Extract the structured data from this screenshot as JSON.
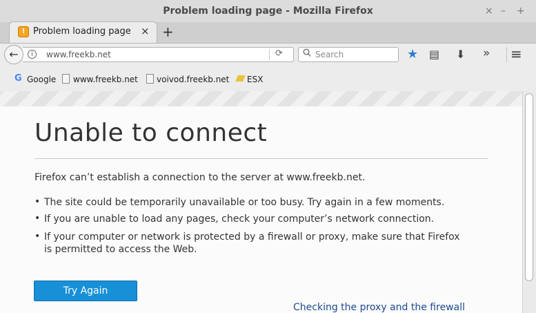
{
  "window": {
    "title": "Problem loading page - Mozilla Firefox",
    "controls": {
      "close": "×",
      "minimize": "–",
      "maximize": "+"
    }
  },
  "tabs": [
    {
      "title": "Problem loading page",
      "close": "×",
      "icon": "warning-icon"
    }
  ],
  "new_tab": "+",
  "navbar": {
    "back": "←",
    "url": "www.freekb.net",
    "reload": "⟳",
    "search_placeholder": "Search",
    "icons": {
      "star": "★",
      "reading_list": "▤",
      "download": "⬇",
      "overflow": "»",
      "menu": "≡"
    }
  },
  "bookmarks": [
    {
      "label": "Google",
      "icon": "google-icon"
    },
    {
      "label": "www.freekb.net",
      "icon": "page-icon"
    },
    {
      "label": "voivod.freekb.net",
      "icon": "page-icon"
    },
    {
      "label": "ESX",
      "icon": "folder-icon"
    }
  ],
  "error": {
    "heading": "Unable to connect",
    "description": "Firefox can’t establish a connection to the server at www.freekb.net.",
    "bullets": [
      "The site could be temporarily unavailable or too busy. Try again in a few moments.",
      "If you are unable to load any pages, check your computer’s network connection.",
      "If your computer or network is protected by a firewall or proxy, make sure that Firefox is permitted to access the Web."
    ],
    "bullet_marker": "•",
    "button_label": "Try Again",
    "cut_off_text": "Checking the proxy and the firewall"
  },
  "colors": {
    "accent_button": "#1790d8",
    "star": "#2a7fd4"
  }
}
